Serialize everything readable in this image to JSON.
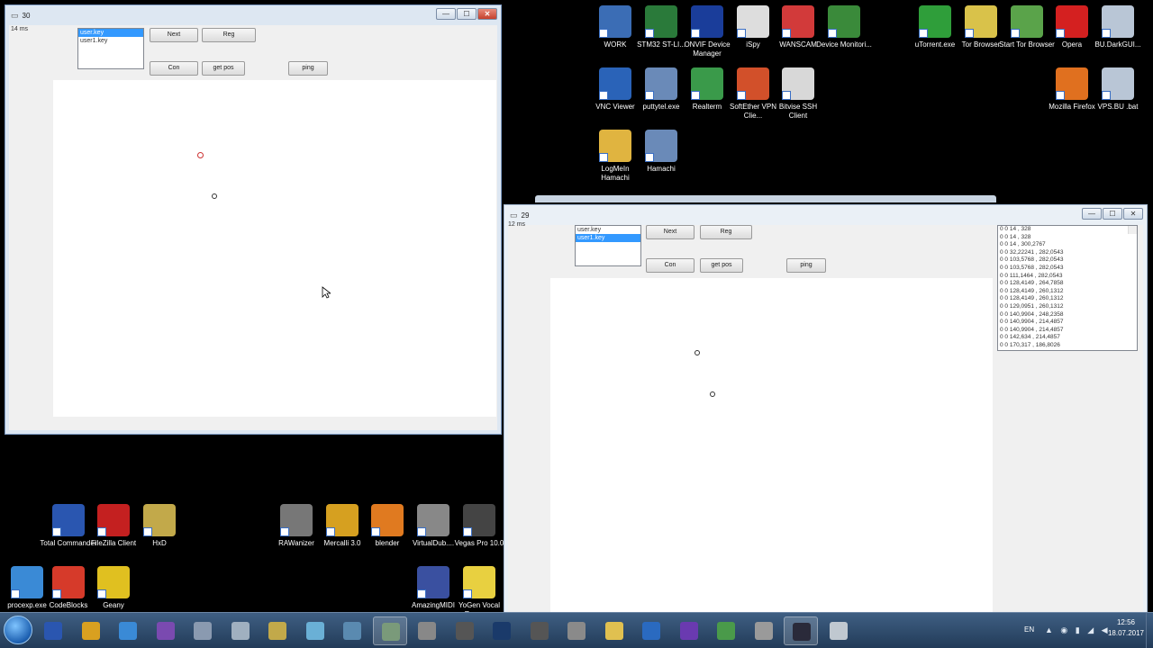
{
  "desktop": {
    "icons_top": [
      {
        "label": "WORK",
        "color": "#3b6db5"
      },
      {
        "label": "STM32 ST-LI...",
        "color": "#2a7a3a"
      },
      {
        "label": "ONVIF Device Manager",
        "color": "#1a3d9a"
      },
      {
        "label": "iSpy",
        "color": "#dddddd"
      },
      {
        "label": "WANSCAM",
        "color": "#d23a3a"
      },
      {
        "label": "Device Monitori...",
        "color": "#3a8a3a"
      },
      {
        "label": "uTorrent.exe",
        "color": "#2f9e3a"
      },
      {
        "label": "Tor Browser",
        "color": "#d9c24a"
      },
      {
        "label": "Start Tor Browser",
        "color": "#5aa34a"
      },
      {
        "label": "Opera",
        "color": "#d42020"
      },
      {
        "label": "BU.DarkGUI...",
        "color": "#b9c6d6"
      },
      {
        "label": "VNC Viewer",
        "color": "#2a63b8"
      },
      {
        "label": "puttytel.exe",
        "color": "#6a8ab8"
      },
      {
        "label": "Realterm",
        "color": "#3a9a4a"
      },
      {
        "label": "SoftEther VPN Clie...",
        "color": "#d2502a"
      },
      {
        "label": "Bitvise SSH Client",
        "color": "#d8d8d8"
      },
      {
        "label": "Mozilla Firefox",
        "color": "#e0701f"
      },
      {
        "label": "VPS.BU .bat",
        "color": "#b9c6d6"
      },
      {
        "label": "LogMeIn Hamachi",
        "color": "#e0b440"
      },
      {
        "label": "Hamachi",
        "color": "#6a8ab8"
      }
    ],
    "icons_bottom": [
      {
        "label": "Total Commander",
        "color": "#2a56b0"
      },
      {
        "label": "FileZilla Client",
        "color": "#c42020"
      },
      {
        "label": "HxD",
        "color": "#c2a94a"
      },
      {
        "label": "RAWanizer",
        "color": "#777777"
      },
      {
        "label": "Mercalli 3.0",
        "color": "#d6a020"
      },
      {
        "label": "blender",
        "color": "#e07a20"
      },
      {
        "label": "VirtualDub....",
        "color": "#888888"
      },
      {
        "label": "Vegas Pro 10.0",
        "color": "#444444"
      },
      {
        "label": "procexp.exe",
        "color": "#3a8ad6"
      },
      {
        "label": "CodeBlocks",
        "color": "#d63a2a"
      },
      {
        "label": "Geany",
        "color": "#e0c020"
      },
      {
        "label": "AmazingMIDI",
        "color": "#3a50a0"
      },
      {
        "label": "YoGen Vocal Remover",
        "color": "#e8d040"
      }
    ]
  },
  "win30": {
    "title": "30",
    "ms": "14 ms",
    "list": [
      "user.key",
      "user1.key"
    ],
    "selected": 0,
    "btn_next": "Next",
    "btn_reg": "Reg",
    "btn_con": "Con",
    "btn_getpos": "get pos",
    "btn_ping": "ping",
    "ctrl_min": "—",
    "ctrl_max": "☐",
    "ctrl_close": "✕"
  },
  "win29": {
    "title": "29",
    "ms": "12 ms",
    "list": [
      "user.key",
      "user1.key"
    ],
    "selected": 1,
    "btn_next": "Next",
    "btn_reg": "Reg",
    "btn_con": "Con",
    "btn_getpos": "get pos",
    "btn_ping": "ping",
    "ctrl_min": "—",
    "ctrl_max": "☐",
    "ctrl_close": "✕",
    "log": [
      "0 0 14 , 328",
      "0 0 14 , 328",
      "0 0 14 , 300,2767",
      "0 0 32,22241 , 282,0543",
      "0 0 103,5768 , 282,0543",
      "0 0 103,5768 , 282,0543",
      "0 0 111,1464 , 282,0543",
      "0 0 128,4149 , 264,7858",
      "0 0 128,4149 , 260,1312",
      "0 0 128,4149 , 260,1312",
      "0 0 129,0951 , 260,1312",
      "0 0 140,9904 , 248,2358",
      "0 0 140,9904 , 214,4857",
      "0 0 140,9904 , 214,4857",
      "0 0 142,634 , 214,4857",
      "0 0 170,317 , 186,8026"
    ]
  },
  "tray": {
    "lang": "EN",
    "time": "12:56",
    "date": "18.07.2017"
  },
  "taskbar": {
    "items": [
      {
        "name": "floppy",
        "color": "#2a56b0",
        "active": false
      },
      {
        "name": "chrome",
        "color": "#d9a020",
        "active": false
      },
      {
        "name": "ie",
        "color": "#3a8ad6",
        "active": false
      },
      {
        "name": "vs",
        "color": "#7a4ab0",
        "active": false
      },
      {
        "name": "app",
        "color": "#8a9ab0",
        "active": false
      },
      {
        "name": "calc",
        "color": "#a0b0c0",
        "active": false
      },
      {
        "name": "hxd",
        "color": "#c2a94a",
        "active": false
      },
      {
        "name": "app2",
        "color": "#6ab0d6",
        "active": false
      },
      {
        "name": "app3",
        "color": "#5a8ab0",
        "active": false
      },
      {
        "name": "app4",
        "color": "#7a9a7a",
        "active": true
      },
      {
        "name": "app5",
        "color": "#888888",
        "active": false
      },
      {
        "name": "fbe",
        "color": "#555555",
        "active": false
      },
      {
        "name": "photoshop",
        "color": "#1a3a6a",
        "active": false
      },
      {
        "name": "fbe2",
        "color": "#555555",
        "active": false
      },
      {
        "name": "tool",
        "color": "#8a8a8a",
        "active": false
      },
      {
        "name": "explorer",
        "color": "#e0c050",
        "active": false
      },
      {
        "name": "app6",
        "color": "#2a6ac0",
        "active": false
      },
      {
        "name": "twitch",
        "color": "#6a3ab0",
        "active": false
      },
      {
        "name": "app7",
        "color": "#4a9a4a",
        "active": false
      },
      {
        "name": "app8",
        "color": "#9a9a9a",
        "active": false
      },
      {
        "name": "app9",
        "color": "#2a2a3a",
        "active": true
      },
      {
        "name": "app10",
        "color": "#c0c8d0",
        "active": false
      }
    ]
  }
}
